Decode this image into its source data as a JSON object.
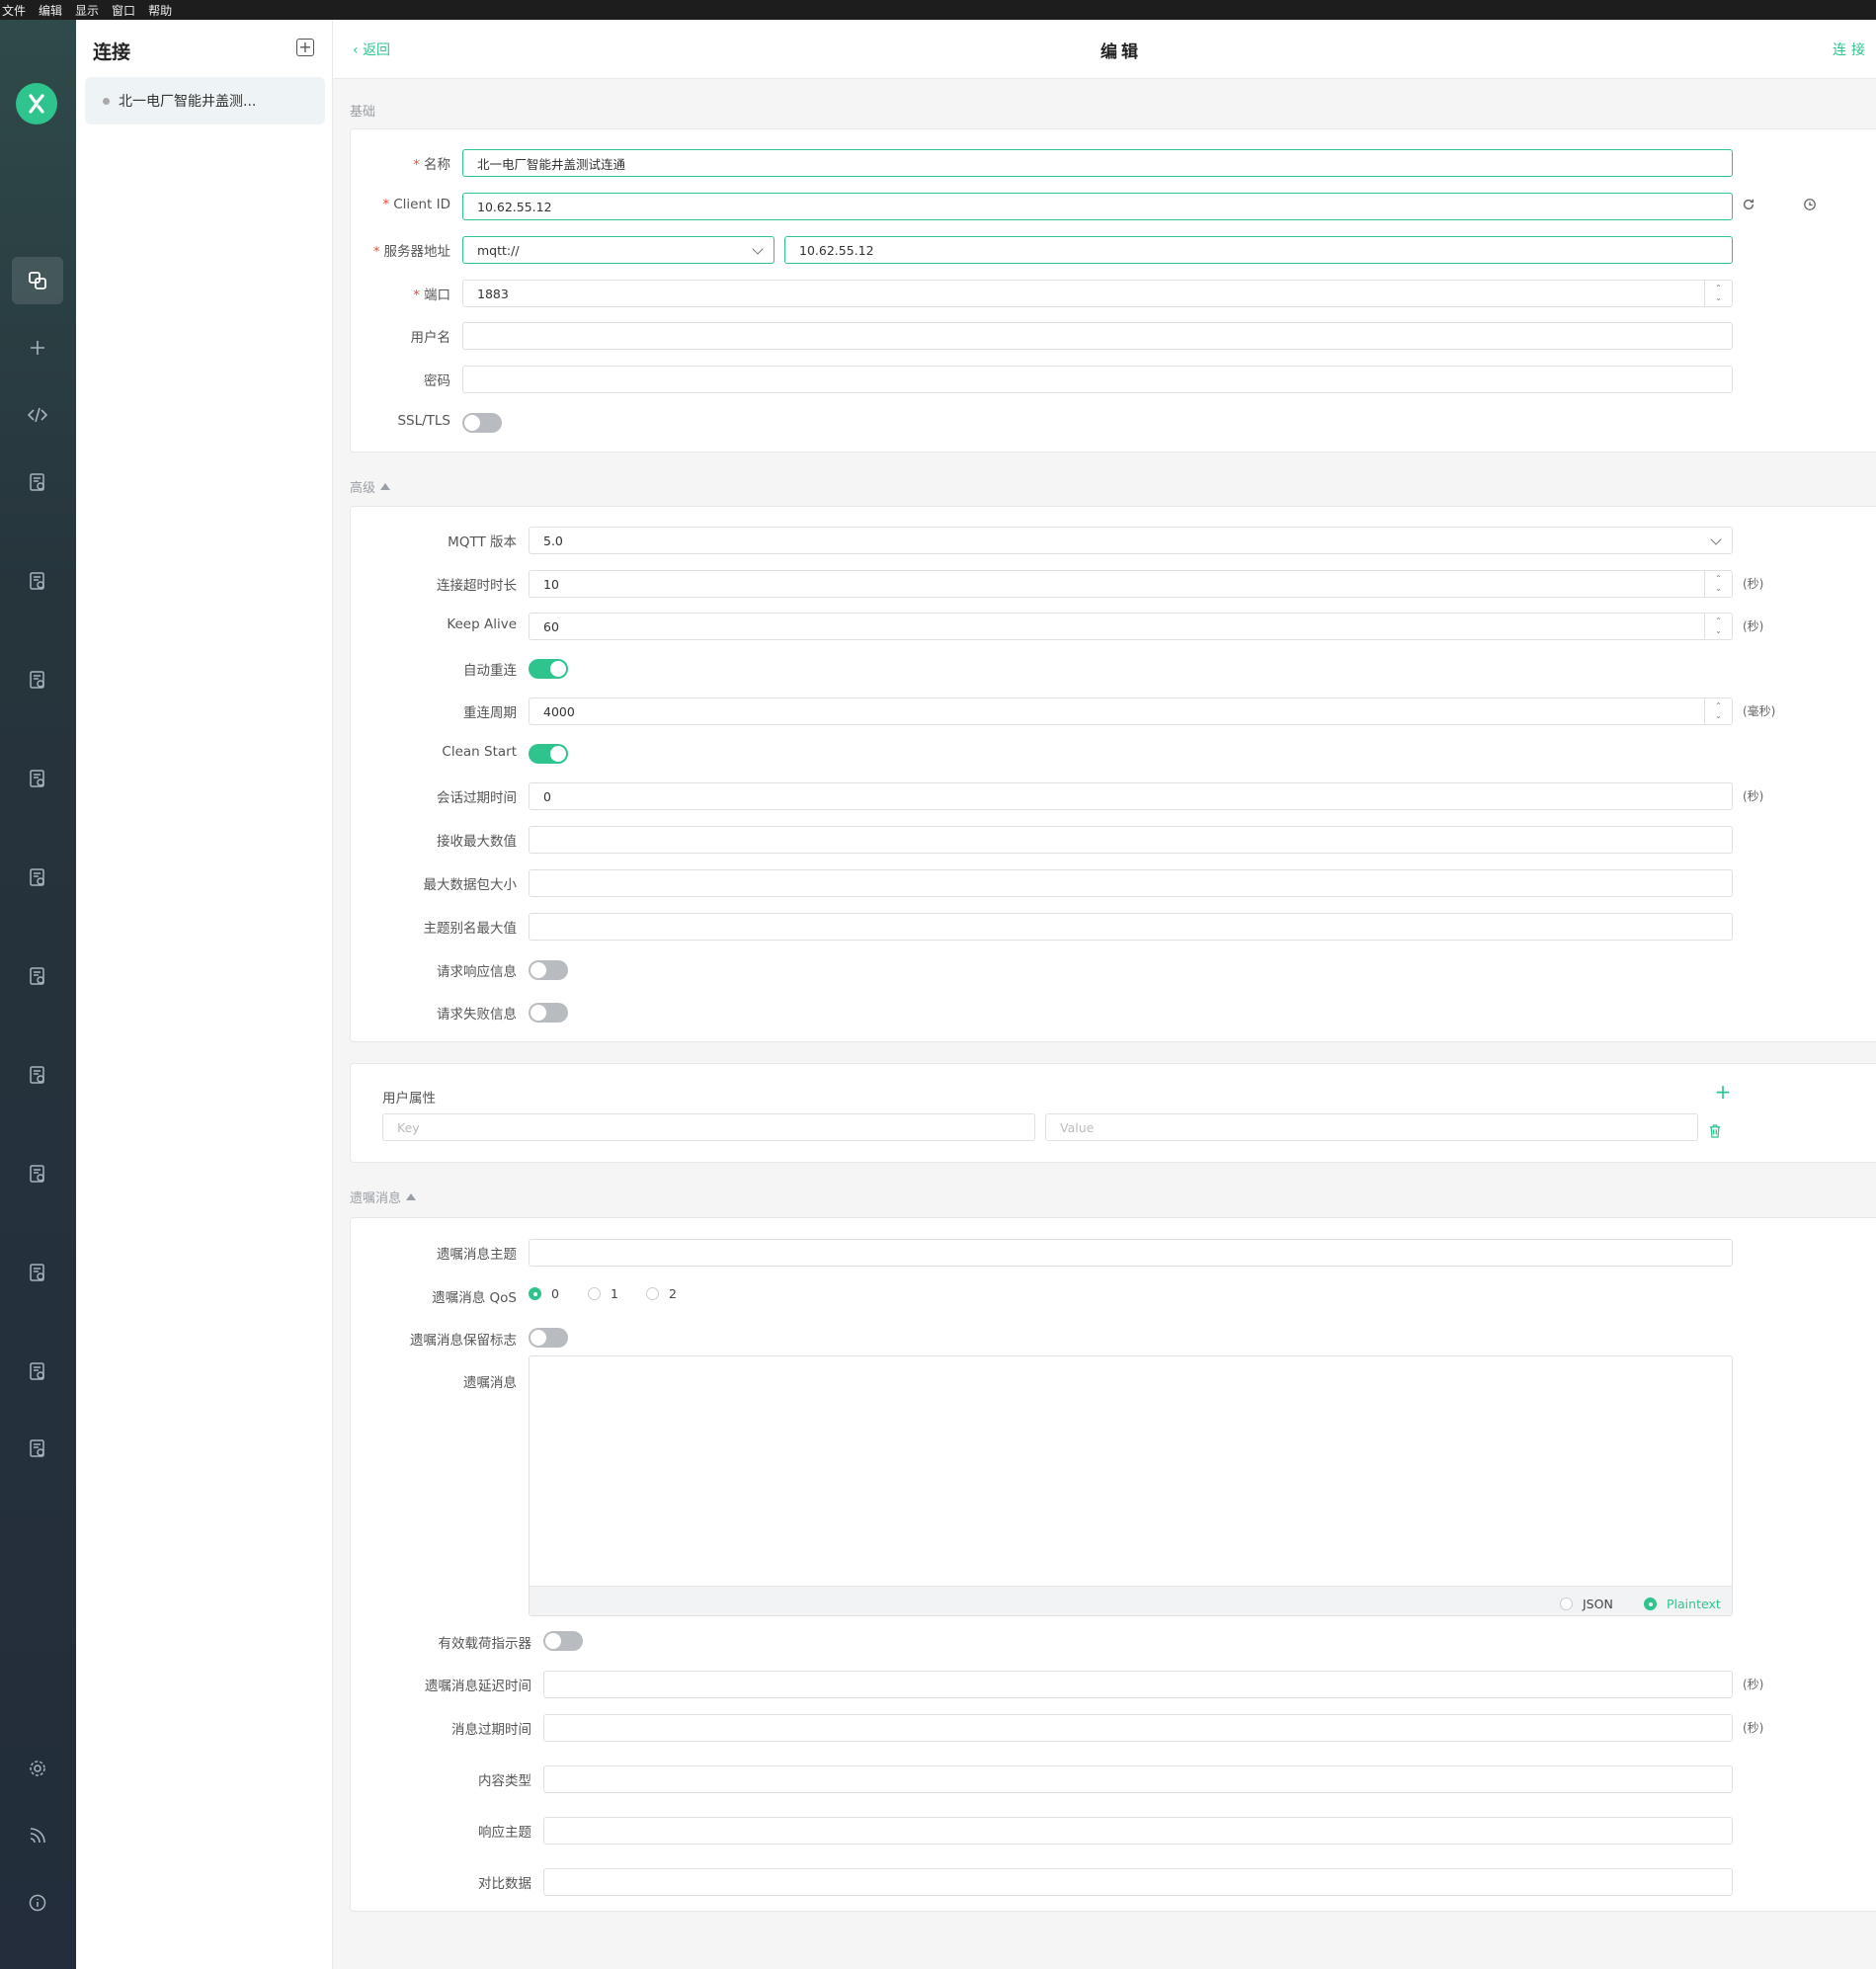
{
  "menu": [
    "文件",
    "编辑",
    "显示",
    "窗口",
    "帮助"
  ],
  "sidebar": {
    "icons": [
      "logo-icon",
      "connections-icon",
      "new-connection-icon",
      "script-icon",
      "log-icon",
      "log-icon",
      "log-icon",
      "log-icon",
      "log-icon",
      "log-icon",
      "log-icon",
      "log-icon",
      "log-icon",
      "log-icon",
      "log-icon",
      "settings-icon",
      "feed-icon",
      "about-icon"
    ]
  },
  "connections": {
    "title": "连接",
    "items": [
      {
        "name": "北一电厂智能井盖测..."
      }
    ]
  },
  "header": {
    "back": "返回",
    "title": "编辑",
    "connect": "连接"
  },
  "basic": {
    "label": "基础",
    "name_label": "名称",
    "name_value": "北一电厂智能井盖测试连通",
    "client_id_label": "Client ID",
    "client_id_value": "10.62.55.12",
    "server_label": "服务器地址",
    "protocol": "mqtt://",
    "host": "10.62.55.12",
    "port_label": "端口",
    "port_value": "1883",
    "username_label": "用户名",
    "username_value": "",
    "password_label": "密码",
    "password_value": "",
    "ssl_label": "SSL/TLS",
    "ssl_on": false
  },
  "advanced": {
    "label": "高级",
    "mqtt_version_label": "MQTT 版本",
    "mqtt_version": "5.0",
    "timeout_label": "连接超时时长",
    "timeout_value": "10",
    "keepalive_label": "Keep Alive",
    "keepalive_value": "60",
    "auto_reconnect_label": "自动重连",
    "auto_reconnect_on": true,
    "reconnect_period_label": "重连周期",
    "reconnect_period_value": "4000",
    "clean_start_label": "Clean Start",
    "clean_start_on": true,
    "session_expiry_label": "会话过期时间",
    "session_expiry_value": "0",
    "receive_max_label": "接收最大数值",
    "max_packet_label": "最大数据包大小",
    "topic_alias_label": "主题别名最大值",
    "request_response_label": "请求响应信息",
    "request_problem_label": "请求失败信息",
    "unit_sec": "(秒)",
    "unit_ms": "(毫秒)"
  },
  "user_props": {
    "label": "用户属性",
    "key_placeholder": "Key",
    "value_placeholder": "Value"
  },
  "will": {
    "label": "遗嘱消息",
    "topic_label": "遗嘱消息主题",
    "qos_label": "遗嘱消息 QoS",
    "qos_options": [
      "0",
      "1",
      "2"
    ],
    "qos_selected": "0",
    "retain_label": "遗嘱消息保留标志",
    "message_label": "遗嘱消息",
    "format_options": [
      "JSON",
      "Plaintext"
    ],
    "format_selected": "Plaintext",
    "payload_indicator_label": "有效载荷指示器",
    "delay_label": "遗嘱消息延迟时间",
    "expiry_label": "消息过期时间",
    "content_type_label": "内容类型",
    "response_topic_label": "响应主题",
    "correlation_label": "对比数据",
    "unit_sec": "(秒)"
  },
  "colors": {
    "accent": "#2fc48d",
    "required": "#e74c3c",
    "sidebar": "#232d3b"
  }
}
